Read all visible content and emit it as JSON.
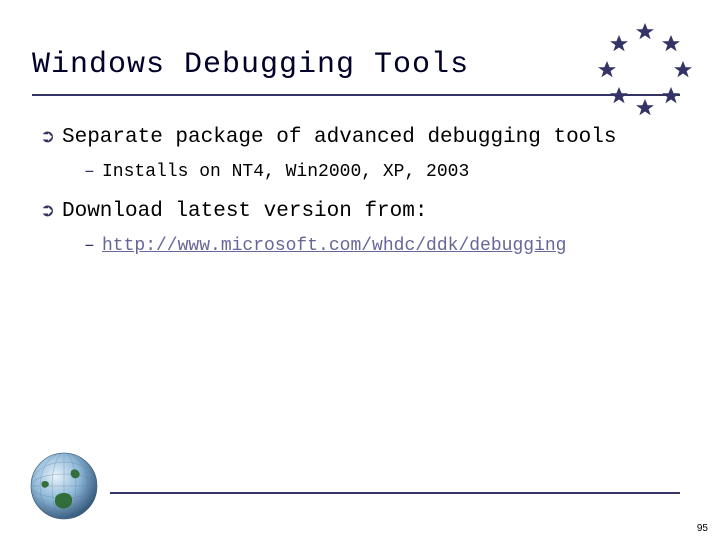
{
  "title": "Windows Debugging Tools",
  "bullets": [
    {
      "text": "Separate package of advanced debugging tools",
      "sub": {
        "text": "Installs on NT4, Win2000, XP, 2003",
        "isLink": false
      }
    },
    {
      "text": "Download latest version from:",
      "sub": {
        "text": "http://www.microsoft.com/whdc/ddk/debugging",
        "isLink": true
      }
    }
  ],
  "pageNumber": "95",
  "icons": {
    "arrow": "➲",
    "dash": "–"
  },
  "colors": {
    "accent": "#333366",
    "link": "#666699"
  }
}
